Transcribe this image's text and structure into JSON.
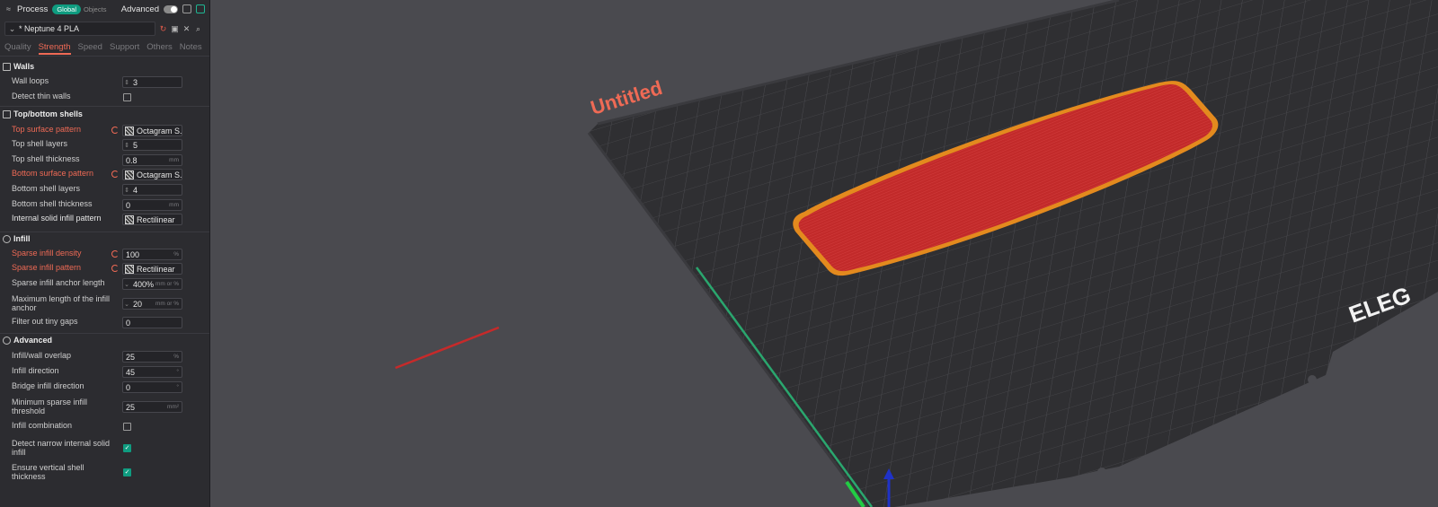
{
  "header": {
    "title": "Process",
    "scope_global": "Global",
    "scope_objects": "Objects",
    "advanced_label": "Advanced"
  },
  "preset": {
    "name": "* Neptune 4 PLA"
  },
  "tabs": [
    "Quality",
    "Strength",
    "Speed",
    "Support",
    "Others",
    "Notes"
  ],
  "active_tab": "Strength",
  "sections": {
    "walls": "Walls",
    "top_bottom": "Top/bottom shells",
    "infill": "Infill",
    "advanced": "Advanced"
  },
  "settings": {
    "wall_loops": {
      "label": "Wall loops",
      "value": "3"
    },
    "detect_thin_walls": {
      "label": "Detect thin walls",
      "checked": false
    },
    "top_surface_pattern": {
      "label": "Top surface pattern",
      "value": "Octagram S..."
    },
    "top_shell_layers": {
      "label": "Top shell layers",
      "value": "5"
    },
    "top_shell_thickness": {
      "label": "Top shell thickness",
      "value": "0.8",
      "unit": "mm"
    },
    "bottom_surface_pattern": {
      "label": "Bottom surface pattern",
      "value": "Octagram S..."
    },
    "bottom_shell_layers": {
      "label": "Bottom shell layers",
      "value": "4"
    },
    "bottom_shell_thickness": {
      "label": "Bottom shell thickness",
      "value": "0",
      "unit": "mm"
    },
    "internal_solid_infill_pattern": {
      "label": "Internal solid infill pattern",
      "value": "Rectilinear"
    },
    "sparse_infill_density": {
      "label": "Sparse infill density",
      "value": "100",
      "unit": "%"
    },
    "sparse_infill_pattern": {
      "label": "Sparse infill pattern",
      "value": "Rectilinear"
    },
    "sparse_infill_anchor_length": {
      "label": "Sparse infill anchor length",
      "value": "400%",
      "unit": "mm or %"
    },
    "max_infill_anchor": {
      "label": "Maximum length of the infill anchor",
      "value": "20",
      "unit": "mm or %"
    },
    "filter_tiny_gaps": {
      "label": "Filter out tiny gaps",
      "value": "0"
    },
    "infill_wall_overlap": {
      "label": "Infill/wall overlap",
      "value": "25",
      "unit": "%"
    },
    "infill_direction": {
      "label": "Infill direction",
      "value": "45",
      "unit": "°"
    },
    "bridge_infill_direction": {
      "label": "Bridge infill direction",
      "value": "0",
      "unit": "°"
    },
    "min_sparse_infill_threshold": {
      "label": "Minimum sparse infill threshold",
      "value": "25",
      "unit": "mm²"
    },
    "infill_combination": {
      "label": "Infill combination",
      "checked": false
    },
    "detect_narrow_internal_solid_infill": {
      "label": "Detect narrow internal solid infill",
      "checked": true
    },
    "ensure_vertical_shell_thickness": {
      "label": "Ensure vertical shell thickness",
      "checked": true
    }
  },
  "viewport": {
    "plate_name": "Untitled",
    "brand_text": "ELEG",
    "colors": {
      "plate": "#2f2f32",
      "model": "#c62a2a",
      "model_outline": "#e38a1e",
      "accent": "#ef6a55",
      "teal": "#0f9c80"
    }
  }
}
